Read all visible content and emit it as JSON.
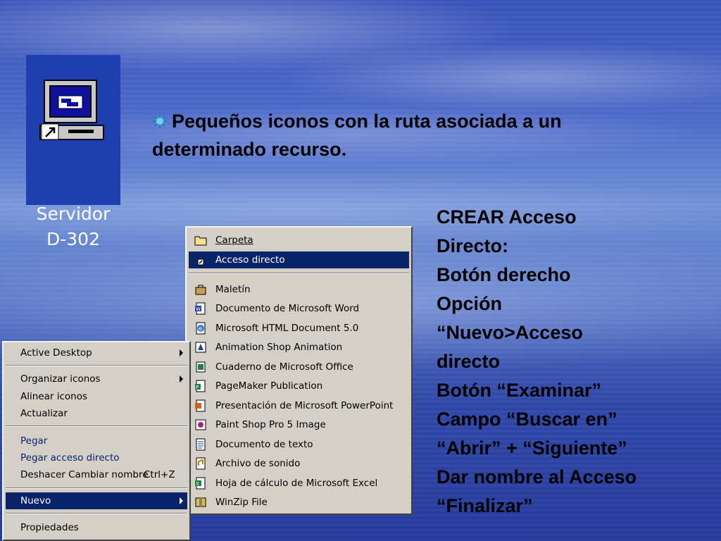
{
  "shortcut": {
    "label_line1": "Servidor",
    "label_line2": "D-302",
    "icon": "computer-shortcut-icon"
  },
  "headline": "Pequeños iconos con la ruta asociada a un determinado recurso.",
  "steps": [
    "CREAR Acceso",
    "Directo:",
    "Botón derecho",
    "Opción",
    "“Nuevo>Acceso",
    "directo",
    "Botón “Examinar”",
    "Campo “Buscar en”",
    "“Abrir” + “Siguiente”",
    "Dar nombre al Acceso",
    "“Finalizar”"
  ],
  "context_menu": {
    "items": [
      {
        "label": "Active Desktop",
        "submenu": true
      },
      {
        "label": "Organizar iconos",
        "submenu": true
      },
      {
        "label": "Alinear iconos"
      },
      {
        "label": "Actualizar"
      },
      {
        "label": "Pegar",
        "disabled": true
      },
      {
        "label": "Pegar acceso directo",
        "disabled": true
      },
      {
        "label": "Deshacer Cambiar nombre",
        "shortcut": "Ctrl+Z"
      },
      {
        "label": "Nuevo",
        "submenu": true,
        "selected": true
      },
      {
        "label": "Propiedades"
      }
    ]
  },
  "new_submenu": {
    "items": [
      {
        "label": "Carpeta",
        "icon": "folder-icon"
      },
      {
        "label": "Acceso directo",
        "icon": "shortcut-icon",
        "selected": true
      },
      {
        "label": "Maletín",
        "icon": "briefcase-icon"
      },
      {
        "label": "Documento de Microsoft Word",
        "icon": "word-document-icon"
      },
      {
        "label": "Microsoft HTML Document 5.0",
        "icon": "html-document-icon"
      },
      {
        "label": "Animation Shop Animation",
        "icon": "animation-icon"
      },
      {
        "label": "Cuaderno de Microsoft Office",
        "icon": "office-binder-icon"
      },
      {
        "label": "PageMaker Publication",
        "icon": "pagemaker-icon"
      },
      {
        "label": "Presentación de Microsoft PowerPoint",
        "icon": "powerpoint-icon"
      },
      {
        "label": "Paint Shop Pro 5 Image",
        "icon": "paint-shop-icon"
      },
      {
        "label": "Documento de texto",
        "icon": "text-document-icon"
      },
      {
        "label": "Archivo de sonido",
        "icon": "sound-file-icon"
      },
      {
        "label": "Hoja de cálculo de Microsoft Excel",
        "icon": "excel-icon"
      },
      {
        "label": "WinZip File",
        "icon": "winzip-icon"
      }
    ]
  },
  "colors": {
    "menu_face": "#d4d0c8",
    "highlight": "#0a246a",
    "shortcut_bg": "#1e3fae"
  }
}
